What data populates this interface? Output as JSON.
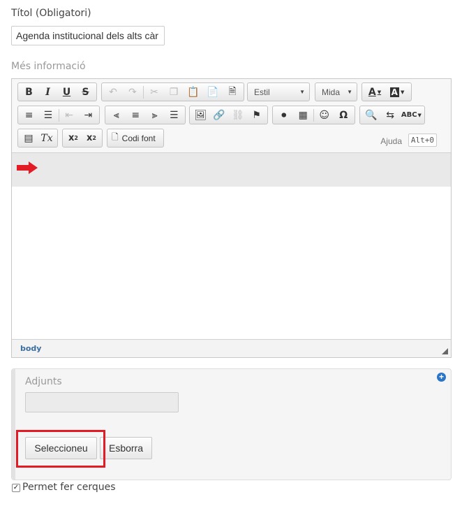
{
  "title_field": {
    "label": "Títol (Obligatori)",
    "value": "Agenda institucional dels alts càr"
  },
  "more_info": {
    "label": "Més informació"
  },
  "editor": {
    "style_combo": "Estil",
    "size_combo": "Mida",
    "source_label": "Codi font",
    "help_label": "Ajuda",
    "help_shortcut": "Alt+0",
    "statusbar_path": "body"
  },
  "attachments": {
    "label": "Adjunts",
    "select_button": "Seleccioneu",
    "delete_button": "Esborra"
  },
  "searchable": {
    "label": "Permet fer cerques",
    "checked": true
  },
  "colors": {
    "highlight": "#e21b25",
    "arrow": "#e21b25",
    "accent": "#2a75c8"
  }
}
